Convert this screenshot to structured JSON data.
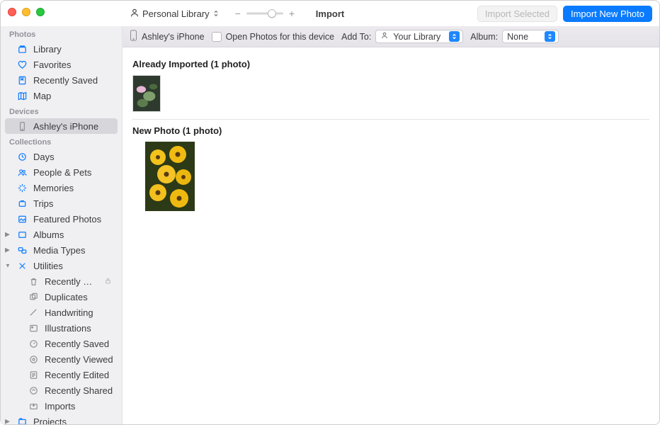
{
  "titlebar": {
    "library_label": "Personal Library",
    "title": "Import",
    "zoom_minus": "−",
    "zoom_plus": "+",
    "import_selected": "Import Selected",
    "import_new": "Import New Photo"
  },
  "importbar": {
    "device_name": "Ashley's iPhone",
    "open_label": "Open Photos for this device",
    "add_to_label": "Add To:",
    "add_to_value": "Your Library",
    "album_label": "Album:",
    "album_value": "None"
  },
  "sidebar": {
    "photos_group": "Photos",
    "photos": [
      {
        "key": "library",
        "label": "Library"
      },
      {
        "key": "favorites",
        "label": "Favorites"
      },
      {
        "key": "recently-saved",
        "label": "Recently Saved"
      },
      {
        "key": "map",
        "label": "Map"
      }
    ],
    "devices_group": "Devices",
    "devices": [
      {
        "key": "iphone",
        "label": "Ashley's iPhone"
      }
    ],
    "collections_group": "Collections",
    "collections": [
      {
        "key": "days",
        "label": "Days"
      },
      {
        "key": "people",
        "label": "People & Pets"
      },
      {
        "key": "memories",
        "label": "Memories"
      },
      {
        "key": "trips",
        "label": "Trips"
      },
      {
        "key": "featured",
        "label": "Featured Photos"
      }
    ],
    "albums": {
      "label": "Albums"
    },
    "media_types": {
      "label": "Media Types"
    },
    "utilities": {
      "label": "Utilities",
      "items": [
        {
          "key": "recently-deleted",
          "label": "Recently Deleted",
          "locked": true
        },
        {
          "key": "duplicates",
          "label": "Duplicates"
        },
        {
          "key": "handwriting",
          "label": "Handwriting"
        },
        {
          "key": "illustrations",
          "label": "Illustrations"
        },
        {
          "key": "recently-saved-u",
          "label": "Recently Saved"
        },
        {
          "key": "recently-viewed",
          "label": "Recently Viewed"
        },
        {
          "key": "recently-edited",
          "label": "Recently Edited"
        },
        {
          "key": "recently-shared",
          "label": "Recently Shared"
        },
        {
          "key": "imports",
          "label": "Imports"
        }
      ]
    },
    "projects": {
      "label": "Projects"
    }
  },
  "content": {
    "already_header": "Already Imported (1 photo)",
    "new_header": "New Photo (1 photo)"
  }
}
